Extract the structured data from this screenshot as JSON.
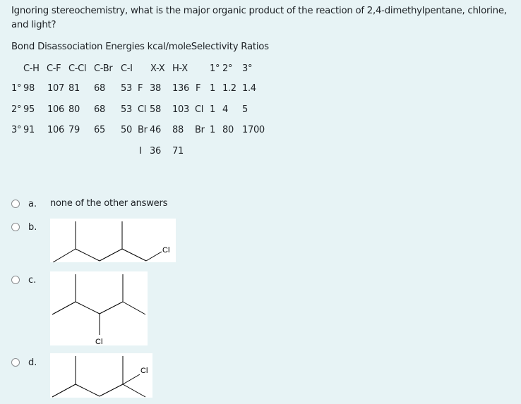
{
  "question": {
    "text": "Ignoring stereochemistry, what is the major organic product of the reaction of 2,4-dimethylpentane, chlorine, and light?",
    "table_title": "Bond Disassociation Energies kcal/moleSelectivity Ratios"
  },
  "bde_table": {
    "headers": [
      "C-H",
      "C-F",
      "C-Cl",
      "C-Br",
      "C-I",
      "X-X",
      "H-X",
      "1°",
      "2°",
      "3°"
    ],
    "rows": [
      {
        "type": "1°",
        "ch": "98",
        "cf": "107",
        "ccl": "81",
        "cbr": "68",
        "ci": "53",
        "x": "F",
        "xx": "38",
        "hx": "136",
        "sx": "F",
        "s1": "1",
        "s2": "1.2",
        "s3": "1.4"
      },
      {
        "type": "2°",
        "ch": "95",
        "cf": "106",
        "ccl": "80",
        "cbr": "68",
        "ci": "53",
        "x": "Cl",
        "xx": "58",
        "hx": "103",
        "sx": "Cl",
        "s1": "1",
        "s2": "4",
        "s3": "5"
      },
      {
        "type": "3°",
        "ch": "91",
        "cf": "106",
        "ccl": "79",
        "cbr": "65",
        "ci": "50",
        "x": "Br",
        "xx": "46",
        "hx": "88",
        "sx": "Br",
        "s1": "1",
        "s2": "80",
        "s3": "1700"
      },
      {
        "x": "I",
        "xx": "36",
        "hx": "71"
      }
    ]
  },
  "options": [
    {
      "letter": "a.",
      "text": "none of the other answers",
      "selected": false
    },
    {
      "letter": "b.",
      "structure": "1-chloro-2,4-dimethylpentane",
      "label": "Cl",
      "selected": false
    },
    {
      "letter": "c.",
      "structure": "3-chloro-2,4-dimethylpentane",
      "label": "Cl",
      "selected": false
    },
    {
      "letter": "d.",
      "structure": "2-chloro-2,4-dimethylpentane",
      "label": "Cl",
      "selected": false
    }
  ]
}
